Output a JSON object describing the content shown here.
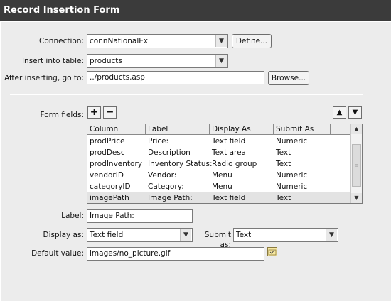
{
  "window": {
    "title": "Record Insertion Form"
  },
  "connection": {
    "label": "Connection:",
    "value": "connNationalEx",
    "define_label": "Define..."
  },
  "insert_table": {
    "label": "Insert into table:",
    "value": "products"
  },
  "after_insert": {
    "label": "After inserting, go to:",
    "value": "../products.asp",
    "browse_label": "Browse..."
  },
  "form_fields": {
    "label": "Form fields:",
    "add_symbol": "+",
    "remove_symbol": "−",
    "move_up_symbol": "▲",
    "move_down_symbol": "▼",
    "columns": [
      "Column",
      "Label",
      "Display As",
      "Submit As"
    ],
    "rows": [
      {
        "column": "prodPrice",
        "label": "Price:",
        "display_as": "Text field",
        "submit_as": "Numeric"
      },
      {
        "column": "prodDesc",
        "label": "Description",
        "display_as": "Text area",
        "submit_as": "Text"
      },
      {
        "column": "prodInventory",
        "label": "Inventory Status:",
        "display_as": "Radio group",
        "submit_as": "Text"
      },
      {
        "column": "vendorID",
        "label": "Vendor:",
        "display_as": "Menu",
        "submit_as": "Numeric"
      },
      {
        "column": "categoryID",
        "label": "Category:",
        "display_as": "Menu",
        "submit_as": "Numeric"
      },
      {
        "column": "imagePath",
        "label": "Image Path:",
        "display_as": "Text field",
        "submit_as": "Text"
      }
    ],
    "selected_row": 5
  },
  "field_label": {
    "label": "Label:",
    "value": "Image Path:"
  },
  "display_as": {
    "label": "Display as:",
    "value": "Text field"
  },
  "submit_as": {
    "label": "Submit as:",
    "value": "Text"
  },
  "default_value": {
    "label": "Default value:",
    "value": "images/no_picture.gif"
  },
  "icons": [
    "chevron-down-icon",
    "chevron-up-icon",
    "grip-icon",
    "dynamic-data-icon"
  ]
}
